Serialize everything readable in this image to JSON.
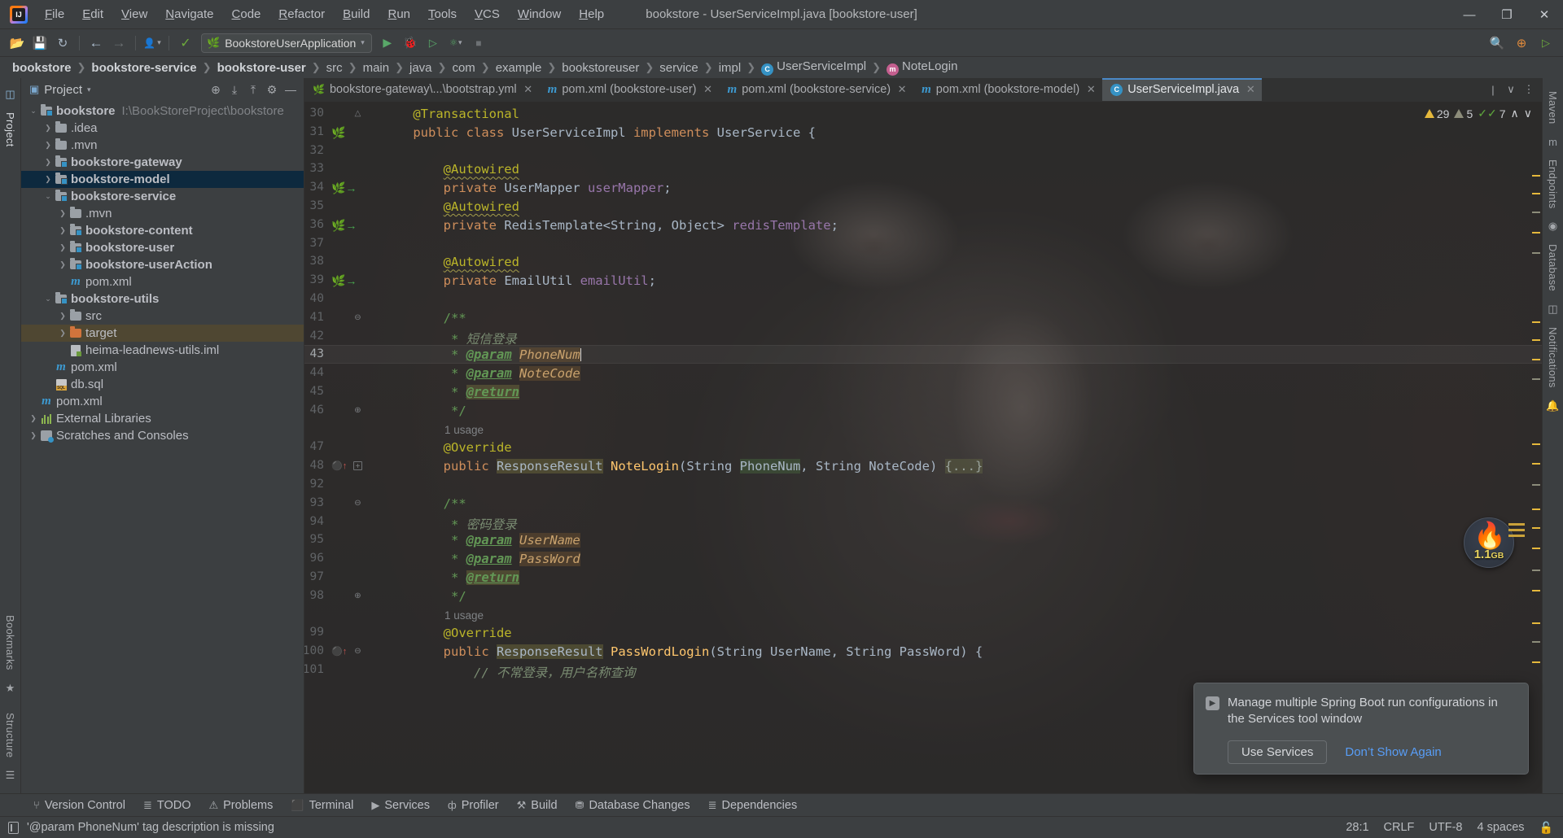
{
  "window": {
    "title": "bookstore - UserServiceImpl.java [bookstore-user]",
    "minimize": "—",
    "maximize": "❐",
    "close": "✕"
  },
  "menubar": [
    {
      "label": "File"
    },
    {
      "label": "Edit"
    },
    {
      "label": "View"
    },
    {
      "label": "Navigate"
    },
    {
      "label": "Code"
    },
    {
      "label": "Refactor"
    },
    {
      "label": "Build"
    },
    {
      "label": "Run"
    },
    {
      "label": "Tools"
    },
    {
      "label": "VCS"
    },
    {
      "label": "Window"
    },
    {
      "label": "Help"
    }
  ],
  "toolbar": {
    "open_icon": "📂",
    "save_icon": "💾",
    "sync_icon": "↻",
    "back_icon": "←",
    "forward_icon": "→",
    "profile_icon": "👤",
    "build_icon": "🔨",
    "run_config": "BookstoreUserApplication",
    "run_icon": "▶",
    "debug_icon": "🐞",
    "run_coverage_icon": "▷",
    "profiler_icon": "⬤",
    "stop_icon": "■",
    "search_icon": "🔍",
    "updates_icon": "⊕",
    "ide_icon": "▶"
  },
  "breadcrumb": [
    {
      "label": "bookstore",
      "bold": true
    },
    {
      "label": "bookstore-service",
      "bold": true
    },
    {
      "label": "bookstore-user",
      "bold": true
    },
    {
      "label": "src",
      "bold": false
    },
    {
      "label": "main",
      "bold": false
    },
    {
      "label": "java",
      "bold": false
    },
    {
      "label": "com",
      "bold": false
    },
    {
      "label": "example",
      "bold": false
    },
    {
      "label": "bookstoreuser",
      "bold": false
    },
    {
      "label": "service",
      "bold": false
    },
    {
      "label": "impl",
      "bold": false
    },
    {
      "label": "UserServiceImpl",
      "bold": false,
      "icon": "class-icon",
      "icon_letter": "C"
    },
    {
      "label": "NoteLogin",
      "bold": false,
      "icon": "method-icon",
      "icon_letter": "m"
    }
  ],
  "left_rail": {
    "project_label": "Project",
    "bookmarks_label": "Bookmarks",
    "structure_label": "Structure",
    "terminal_icon": "▣"
  },
  "right_rail": {
    "maven_label": "Maven",
    "endpoints_label": "Endpoints",
    "database_label": "Database",
    "notifications_label": "Notifications"
  },
  "project_panel": {
    "title": "Project",
    "title_caret": "▾",
    "panel_icon": "▣",
    "header_icons": [
      {
        "name": "locate-icon",
        "glyph": "⊕"
      },
      {
        "name": "expand-all-icon",
        "glyph": "⤓"
      },
      {
        "name": "collapse-all-icon",
        "glyph": "⤒"
      },
      {
        "name": "gear-icon",
        "glyph": "⚙"
      },
      {
        "name": "hide-icon",
        "glyph": "—"
      }
    ],
    "tree": [
      {
        "depth": 0,
        "arrow": "v",
        "icon": "module-folder",
        "label": "bookstore",
        "bold": true,
        "path": "I:\\BookStoreProject\\bookstore",
        "state": "normal"
      },
      {
        "depth": 1,
        "arrow": ">",
        "icon": "folder",
        "label": ".idea",
        "bold": false,
        "state": "normal"
      },
      {
        "depth": 1,
        "arrow": ">",
        "icon": "folder",
        "label": ".mvn",
        "bold": false,
        "state": "normal"
      },
      {
        "depth": 1,
        "arrow": ">",
        "icon": "module-folder",
        "label": "bookstore-gateway",
        "bold": true,
        "state": "normal"
      },
      {
        "depth": 1,
        "arrow": ">",
        "icon": "module-folder",
        "label": "bookstore-model",
        "bold": true,
        "state": "selected"
      },
      {
        "depth": 1,
        "arrow": "v",
        "icon": "module-folder",
        "label": "bookstore-service",
        "bold": true,
        "state": "normal"
      },
      {
        "depth": 2,
        "arrow": ">",
        "icon": "folder",
        "label": ".mvn",
        "bold": false,
        "state": "normal"
      },
      {
        "depth": 2,
        "arrow": ">",
        "icon": "module-folder",
        "label": "bookstore-content",
        "bold": true,
        "state": "normal"
      },
      {
        "depth": 2,
        "arrow": ">",
        "icon": "module-folder",
        "label": "bookstore-user",
        "bold": true,
        "state": "normal"
      },
      {
        "depth": 2,
        "arrow": ">",
        "icon": "module-folder",
        "label": "bookstore-userAction",
        "bold": true,
        "state": "normal"
      },
      {
        "depth": 2,
        "arrow": "",
        "icon": "maven-file",
        "label": "pom.xml",
        "bold": false,
        "state": "normal"
      },
      {
        "depth": 1,
        "arrow": "v",
        "icon": "module-folder",
        "label": "bookstore-utils",
        "bold": true,
        "state": "normal"
      },
      {
        "depth": 2,
        "arrow": ">",
        "icon": "folder",
        "label": "src",
        "bold": false,
        "state": "normal"
      },
      {
        "depth": 2,
        "arrow": ">",
        "icon": "orange-folder",
        "label": "target",
        "bold": false,
        "state": "highlighted"
      },
      {
        "depth": 2,
        "arrow": "",
        "icon": "iml-file",
        "label": "heima-leadnews-utils.iml",
        "bold": false,
        "state": "normal"
      },
      {
        "depth": 1,
        "arrow": "",
        "icon": "maven-file",
        "label": "pom.xml",
        "bold": false,
        "state": "normal"
      },
      {
        "depth": 1,
        "arrow": "",
        "icon": "sql-file",
        "label": "db.sql",
        "bold": false,
        "state": "normal"
      },
      {
        "depth": 0,
        "arrow": "",
        "icon": "maven-file",
        "label": "pom.xml",
        "bold": false,
        "state": "normal"
      },
      {
        "depth": 0,
        "arrow": ">",
        "icon": "library",
        "label": "External Libraries",
        "bold": false,
        "state": "normal"
      },
      {
        "depth": 0,
        "arrow": ">",
        "icon": "scratch",
        "label": "Scratches and Consoles",
        "bold": false,
        "state": "normal"
      }
    ]
  },
  "editor": {
    "tabs": [
      {
        "label": "bookstore-gateway\\...\\bootstrap.yml",
        "icon": "yaml-icon",
        "active": false,
        "close": "✕"
      },
      {
        "label": "pom.xml (bookstore-user)",
        "icon": "maven-icon",
        "active": false,
        "close": "✕"
      },
      {
        "label": "pom.xml (bookstore-service)",
        "icon": "maven-icon",
        "active": false,
        "close": "✕"
      },
      {
        "label": "pom.xml (bookstore-model)",
        "icon": "maven-icon",
        "active": false,
        "close": "✕"
      },
      {
        "label": "UserServiceImpl.java",
        "icon": "class-icon",
        "active": true,
        "close": "✕"
      }
    ],
    "tabbar_right": [
      {
        "name": "split-icon",
        "glyph": "|"
      },
      {
        "name": "chevron-down-icon",
        "glyph": "∨"
      },
      {
        "name": "more-options-icon",
        "glyph": "⋮"
      }
    ],
    "inspections": {
      "warnings": "29",
      "weak_warnings": "5",
      "checks": "7",
      "prev_icon": "∧",
      "next_icon": "∨"
    },
    "memory": {
      "value": "1.1",
      "unit": "GB",
      "icon": "flame-icon",
      "glyph": "🔥"
    },
    "lines": [
      {
        "n": "30",
        "gutter": "",
        "fold": "fold-end-top",
        "segments": [
          {
            "t": "    ",
            "c": "k-plain"
          },
          {
            "t": "@Transactional",
            "c": "k-ann"
          }
        ]
      },
      {
        "n": "31",
        "gutter": "bean",
        "fold": "",
        "segments": [
          {
            "t": "    ",
            "c": "k-plain"
          },
          {
            "t": "public class ",
            "c": "k-kw"
          },
          {
            "t": "UserServiceImpl ",
            "c": "k-cls"
          },
          {
            "t": "implements ",
            "c": "k-kw"
          },
          {
            "t": "UserService {",
            "c": "k-cls"
          }
        ]
      },
      {
        "n": "32",
        "gutter": "",
        "fold": "",
        "segments": []
      },
      {
        "n": "33",
        "gutter": "",
        "fold": "",
        "segments": [
          {
            "t": "        ",
            "c": "k-plain"
          },
          {
            "t": "@Autowired",
            "c": "k-ann squig"
          }
        ]
      },
      {
        "n": "34",
        "gutter": "bean-arrow",
        "fold": "",
        "segments": [
          {
            "t": "        ",
            "c": "k-plain"
          },
          {
            "t": "private ",
            "c": "k-kw"
          },
          {
            "t": "UserMapper ",
            "c": "k-type"
          },
          {
            "t": "userMapper",
            "c": "k-field"
          },
          {
            "t": ";",
            "c": "k-plain"
          }
        ]
      },
      {
        "n": "35",
        "gutter": "",
        "fold": "",
        "segments": [
          {
            "t": "        ",
            "c": "k-plain"
          },
          {
            "t": "@Autowired",
            "c": "k-ann squig"
          }
        ]
      },
      {
        "n": "36",
        "gutter": "bean-arrow",
        "fold": "",
        "segments": [
          {
            "t": "        ",
            "c": "k-plain"
          },
          {
            "t": "private ",
            "c": "k-kw"
          },
          {
            "t": "RedisTemplate<String, Object> ",
            "c": "k-type"
          },
          {
            "t": "redisTemplate",
            "c": "k-field"
          },
          {
            "t": ";",
            "c": "k-plain"
          }
        ]
      },
      {
        "n": "37",
        "gutter": "",
        "fold": "",
        "segments": []
      },
      {
        "n": "38",
        "gutter": "",
        "fold": "",
        "segments": [
          {
            "t": "        ",
            "c": "k-plain"
          },
          {
            "t": "@Autowired",
            "c": "k-ann squig"
          }
        ]
      },
      {
        "n": "39",
        "gutter": "bean-arrow",
        "fold": "",
        "segments": [
          {
            "t": "        ",
            "c": "k-plain"
          },
          {
            "t": "private ",
            "c": "k-kw"
          },
          {
            "t": "EmailUtil ",
            "c": "k-type"
          },
          {
            "t": "emailUtil",
            "c": "k-field"
          },
          {
            "t": ";",
            "c": "k-plain"
          }
        ]
      },
      {
        "n": "40",
        "gutter": "",
        "fold": "",
        "segments": []
      },
      {
        "n": "41",
        "gutter": "",
        "fold": "fold-start",
        "segments": [
          {
            "t": "        ",
            "c": "k-plain"
          },
          {
            "t": "/**",
            "c": "k-cmt"
          }
        ]
      },
      {
        "n": "42",
        "gutter": "",
        "fold": "",
        "segments": [
          {
            "t": "         * ",
            "c": "k-cmt"
          },
          {
            "t": "短信登录",
            "c": "k-cmt2"
          }
        ]
      },
      {
        "n": "43",
        "gutter": "",
        "fold": "",
        "current": true,
        "segments": [
          {
            "t": "         * ",
            "c": "k-cmt"
          },
          {
            "t": "@param",
            "c": "k-tag"
          },
          {
            "t": " ",
            "c": "k-cmt"
          },
          {
            "t": "PhoneNum",
            "c": "k-param hl-brown"
          },
          {
            "t": "|cursor|",
            "c": "cursor"
          }
        ]
      },
      {
        "n": "44",
        "gutter": "",
        "fold": "",
        "segments": [
          {
            "t": "         * ",
            "c": "k-cmt"
          },
          {
            "t": "@param",
            "c": "k-tag"
          },
          {
            "t": " ",
            "c": "k-cmt"
          },
          {
            "t": "NoteCode",
            "c": "k-param hl-brown"
          }
        ]
      },
      {
        "n": "45",
        "gutter": "",
        "fold": "",
        "segments": [
          {
            "t": "         * ",
            "c": "k-cmt"
          },
          {
            "t": "@return",
            "c": "k-tag hl-olive"
          }
        ]
      },
      {
        "n": "46",
        "gutter": "",
        "fold": "fold-end",
        "segments": [
          {
            "t": "         */",
            "c": "k-cmt"
          }
        ]
      },
      {
        "n": "",
        "gutter": "",
        "fold": "",
        "usage": "1 usage",
        "segments": []
      },
      {
        "n": "47",
        "gutter": "",
        "fold": "",
        "segments": [
          {
            "t": "        ",
            "c": "k-plain"
          },
          {
            "t": "@Override",
            "c": "k-ann"
          }
        ]
      },
      {
        "n": "48",
        "gutter": "override",
        "fold": "fold-box-plus",
        "segments": [
          {
            "t": "        ",
            "c": "k-plain"
          },
          {
            "t": "public ",
            "c": "k-kw"
          },
          {
            "t": "ResponseResult",
            "c": "k-type hl-olive"
          },
          {
            "t": " ",
            "c": "k-plain"
          },
          {
            "t": "NoteLogin",
            "c": "k-mth"
          },
          {
            "t": "(String ",
            "c": "k-plain"
          },
          {
            "t": "PhoneNum",
            "c": "k-plain hl-green"
          },
          {
            "t": ", String ",
            "c": "k-plain"
          },
          {
            "t": "NoteCode",
            "c": "k-plain"
          },
          {
            "t": ") ",
            "c": "k-plain"
          },
          {
            "t": "{...}",
            "c": "folded"
          }
        ]
      },
      {
        "n": "92",
        "gutter": "",
        "fold": "",
        "segments": []
      },
      {
        "n": "93",
        "gutter": "",
        "fold": "fold-start",
        "segments": [
          {
            "t": "        ",
            "c": "k-plain"
          },
          {
            "t": "/**",
            "c": "k-cmt"
          }
        ]
      },
      {
        "n": "94",
        "gutter": "",
        "fold": "",
        "segments": [
          {
            "t": "         * ",
            "c": "k-cmt"
          },
          {
            "t": "密码登录",
            "c": "k-cmt2"
          }
        ]
      },
      {
        "n": "95",
        "gutter": "",
        "fold": "",
        "segments": [
          {
            "t": "         * ",
            "c": "k-cmt"
          },
          {
            "t": "@param",
            "c": "k-tag"
          },
          {
            "t": " ",
            "c": "k-cmt"
          },
          {
            "t": "UserName",
            "c": "k-param hl-brown"
          }
        ]
      },
      {
        "n": "96",
        "gutter": "",
        "fold": "",
        "segments": [
          {
            "t": "         * ",
            "c": "k-cmt"
          },
          {
            "t": "@param",
            "c": "k-tag"
          },
          {
            "t": " ",
            "c": "k-cmt"
          },
          {
            "t": "PassWord",
            "c": "k-param hl-brown"
          }
        ]
      },
      {
        "n": "97",
        "gutter": "",
        "fold": "",
        "segments": [
          {
            "t": "         * ",
            "c": "k-cmt"
          },
          {
            "t": "@return",
            "c": "k-tag hl-olive"
          }
        ]
      },
      {
        "n": "98",
        "gutter": "",
        "fold": "fold-end",
        "segments": [
          {
            "t": "         */",
            "c": "k-cmt"
          }
        ]
      },
      {
        "n": "",
        "gutter": "",
        "fold": "",
        "usage": "1 usage",
        "segments": []
      },
      {
        "n": "99",
        "gutter": "",
        "fold": "",
        "segments": [
          {
            "t": "        ",
            "c": "k-plain"
          },
          {
            "t": "@Override",
            "c": "k-ann"
          }
        ]
      },
      {
        "n": "100",
        "gutter": "override",
        "fold": "fold-start",
        "segments": [
          {
            "t": "        ",
            "c": "k-plain"
          },
          {
            "t": "public ",
            "c": "k-kw"
          },
          {
            "t": "ResponseResult",
            "c": "k-type hl-olive"
          },
          {
            "t": " ",
            "c": "k-plain"
          },
          {
            "t": "PassWordLogin",
            "c": "k-mth"
          },
          {
            "t": "(String UserName, String PassWord) {",
            "c": "k-plain"
          }
        ]
      },
      {
        "n": "101",
        "gutter": "",
        "fold": "",
        "segments": [
          {
            "t": "            // 不常登录，用户名称查询",
            "c": "k-cmt2"
          }
        ]
      }
    ]
  },
  "notification": {
    "icon": "services-icon",
    "icon_glyph": "▶",
    "message": "Manage multiple Spring Boot run configurations in the Services tool window",
    "primary_button": "Use Services",
    "secondary_link": "Don’t Show Again"
  },
  "tool_windows": [
    {
      "label": "Version Control",
      "icon": "branch-icon",
      "glyph": "⑂"
    },
    {
      "label": "TODO",
      "icon": "list-icon",
      "glyph": "≣"
    },
    {
      "label": "Problems",
      "icon": "error-icon",
      "glyph": "⚠"
    },
    {
      "label": "Terminal",
      "icon": "terminal-icon",
      "glyph": "⬛"
    },
    {
      "label": "Services",
      "icon": "services-icon",
      "glyph": "▶"
    },
    {
      "label": "Profiler",
      "icon": "profiler-icon",
      "glyph": "ф"
    },
    {
      "label": "Build",
      "icon": "hammer-icon",
      "glyph": "⚒"
    },
    {
      "label": "Database Changes",
      "icon": "database-icon",
      "glyph": "⛃"
    },
    {
      "label": "Dependencies",
      "icon": "dependencies-icon",
      "glyph": "≣"
    }
  ],
  "statusbar": {
    "message": "'@param PhoneNum' tag description is missing",
    "caret_position": "28:1",
    "line_separator": "CRLF",
    "encoding": "UTF-8",
    "indent": "4 spaces",
    "lock_icon": "🔓"
  },
  "colors": {
    "accent": "#4a88c7",
    "selection": "#0d293e",
    "highlight": "#4f4732",
    "link": "#589df6",
    "warning": "#e5b83c",
    "ok": "#5fa83c",
    "editor_bg": "#2b2b2b",
    "chrome_bg": "#3c3f41"
  }
}
